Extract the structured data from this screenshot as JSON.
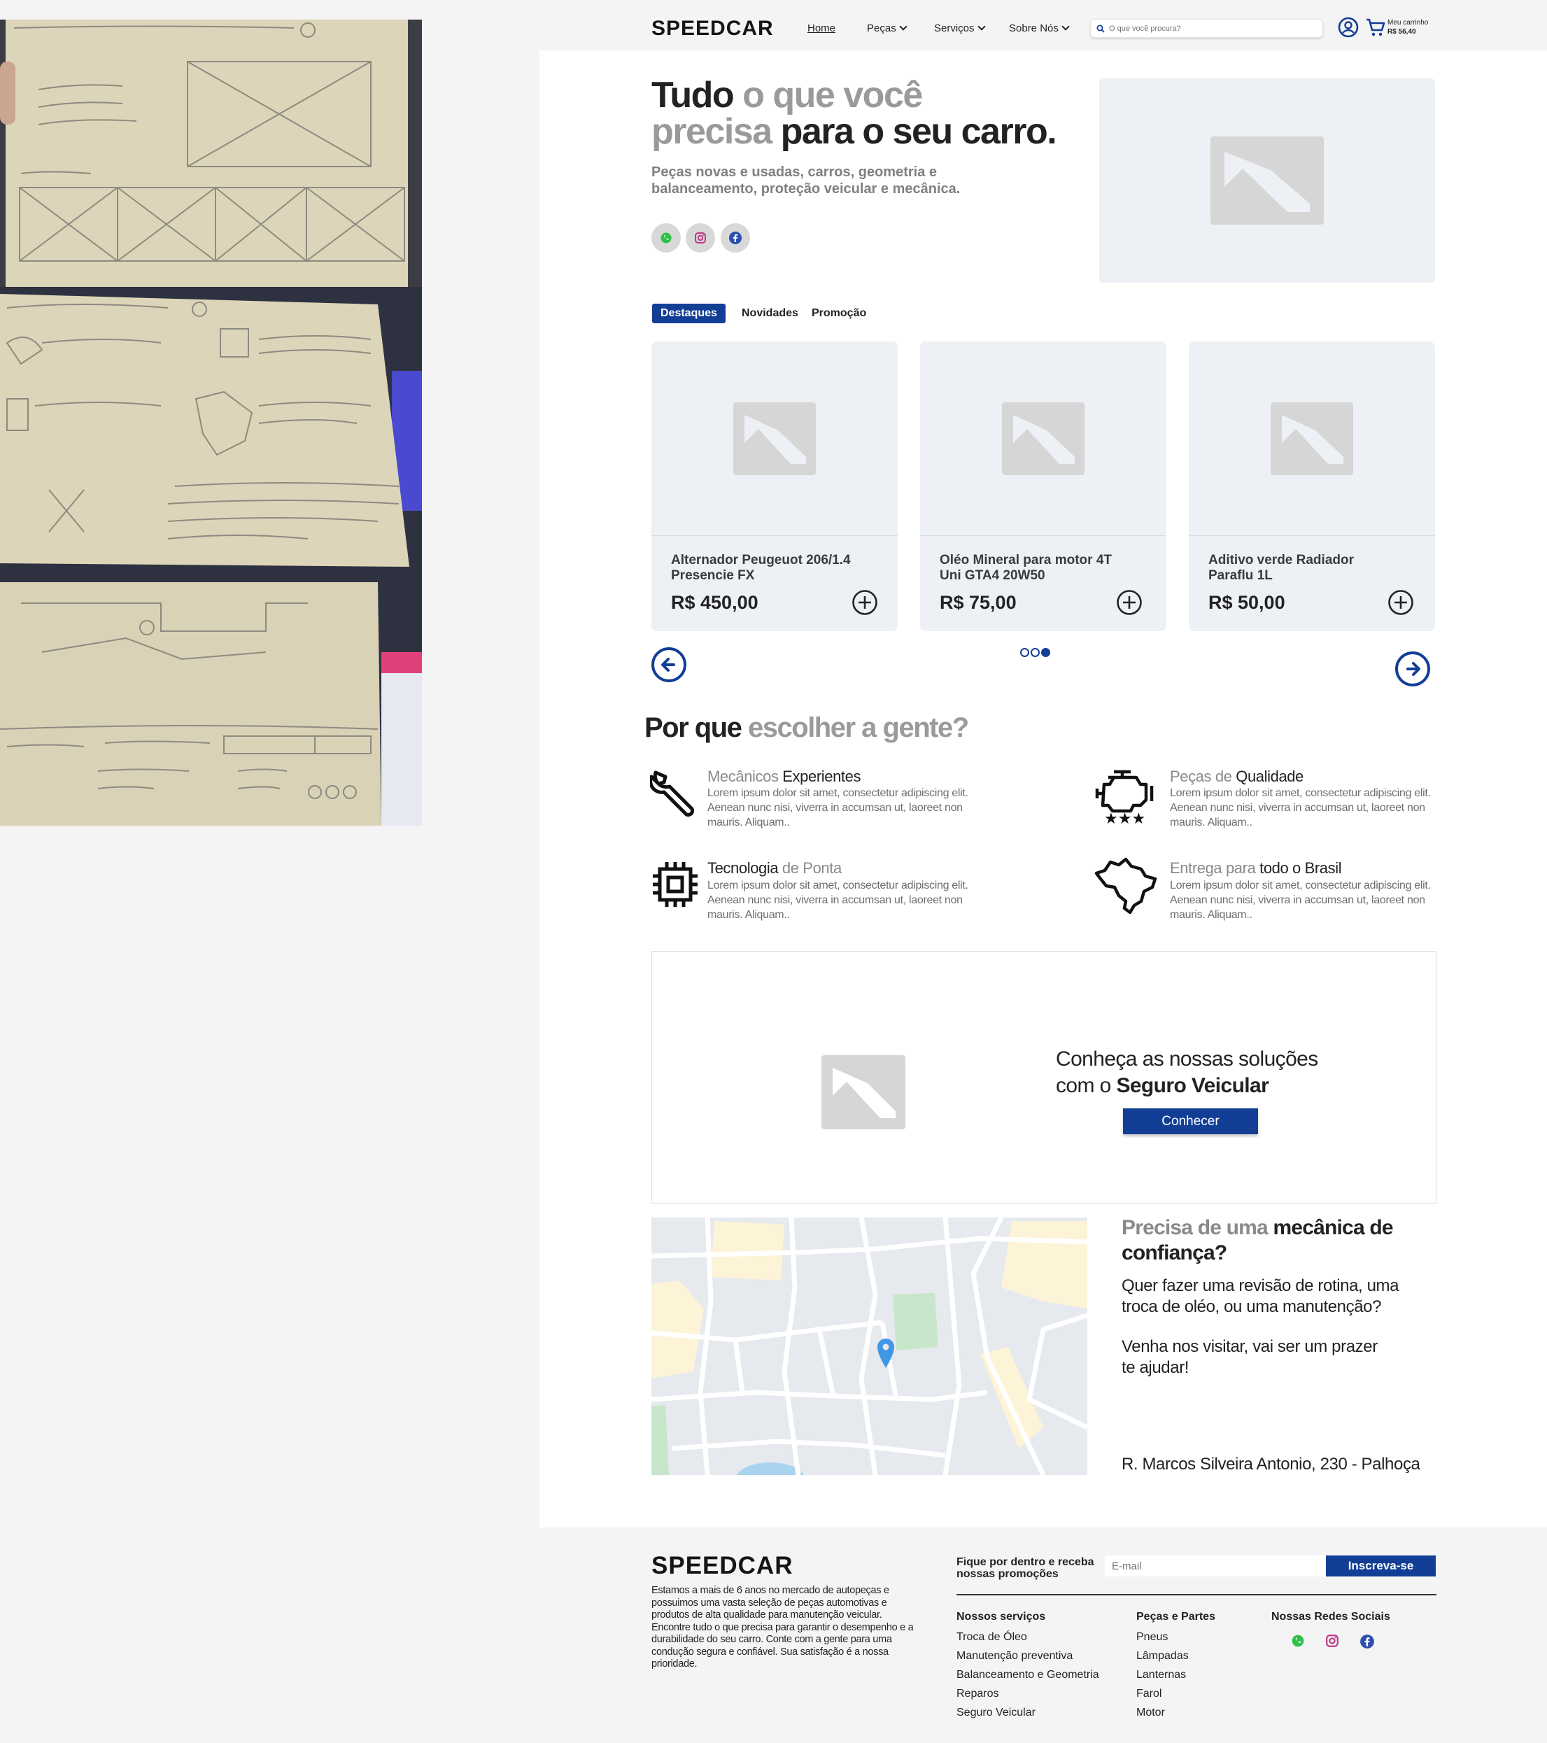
{
  "nav": {
    "logo": "SPEEDCAR",
    "links": [
      {
        "label": "Home",
        "active": true
      },
      {
        "label": "Peças"
      },
      {
        "label": "Serviços"
      },
      {
        "label": "Sobre Nós"
      }
    ],
    "search_placeholder": "O que você procura?",
    "cart_label": "Meu carrinho",
    "cart_total": "R$ 56,40"
  },
  "hero": {
    "title_dark_1": "Tudo",
    "title_grey_1": " o que você",
    "title_grey_2": "precisa",
    "title_dark_2": " para o seu carro.",
    "subtitle": "Peças novas e usadas, carros, geometria e balanceamento, proteção veicular e mecânica.",
    "socials": [
      "whatsapp-icon",
      "instagram-icon",
      "facebook-icon"
    ]
  },
  "tabs": [
    "Destaques",
    "Novidades",
    "Promoção"
  ],
  "products": [
    {
      "name": "Alternador Peugeuot 206/1.4 Presencie FX",
      "price": "R$ 450,00"
    },
    {
      "name": "Oléo Mineral para motor 4T Uni GTA4 20W50",
      "price": "R$ 75,00"
    },
    {
      "name": "Aditivo verde Radiador Paraflu 1L",
      "price": "R$ 50,00"
    }
  ],
  "why": {
    "title_dark": "Por que",
    "title_grey": " escolher a gente?",
    "features": [
      {
        "light": "Mecânicos ",
        "bold": "Experientes",
        "bold_weight": "normal",
        "text": "Lorem ipsum dolor sit amet, consectetur adipiscing elit. Aenean nunc nisi, viverra in accumsan ut, laoreet non mauris. Aliquam..",
        "icon": "wrench-icon"
      },
      {
        "light": "Peças de ",
        "bold": "Qualidade",
        "text": "Lorem ipsum dolor sit amet, consectetur adipiscing elit. Aenean nunc nisi, viverra in accumsan ut, laoreet non mauris. Aliquam..",
        "icon": "engine-icon"
      },
      {
        "light": "",
        "bold": "Tecnologia",
        "light2": " de Ponta",
        "text": "Lorem ipsum dolor sit amet, consectetur adipiscing elit. Aenean nunc nisi, viverra in accumsan ut, laoreet non mauris. Aliquam..",
        "icon": "chip-icon"
      },
      {
        "light": "Entrega para ",
        "bold": "todo o Brasil",
        "text": "Lorem ipsum dolor sit amet, consectetur adipiscing elit. Aenean nunc nisi, viverra in accumsan ut, laoreet non mauris. Aliquam..",
        "icon": "brazil-map-icon"
      }
    ]
  },
  "insurance": {
    "line1": "Conheça as nossas soluções",
    "line2_prefix": "com o ",
    "line2_bold": "Seguro Veicular",
    "cta": "Conhecer"
  },
  "visit": {
    "title_light": "Precisa de uma ",
    "title_bold": "mecânica de confiança?",
    "text1": "Quer fazer uma revisão de rotina, uma troca de oléo, ou uma manutenção?",
    "text2": "Venha nos visitar, vai ser um prazer te ajudar!",
    "address": "R. Marcos Silveira Antonio, 230 - Palhoça"
  },
  "footer": {
    "logo": "SPEEDCAR",
    "about": "Estamos a mais de 6 anos no mercado de autopeças e possuimos uma vasta seleção de peças automotivas e produtos de alta qualidade para manutenção veicular. Encontre tudo o que precisa para garantir o desempenho e a durabilidade do seu carro. Conte com a gente para uma condução segura e confiável. Sua satisfação é a nossa prioridade.",
    "newsletter_label": "Fique por dentro e receba nossas promoções",
    "email_placeholder": "E-mail",
    "subscribe": "Inscreva-se",
    "services_title": "Nossos serviços",
    "services": [
      "Troca de Óleo",
      "Manutenção preventiva",
      "Balanceamento e Geometria",
      "Reparos",
      "Seguro Veicular"
    ],
    "parts_title": "Peças e Partes",
    "parts": [
      "Pneus",
      "Lâmpadas",
      "Lanternas",
      "Farol",
      "Motor"
    ],
    "social_title": "Nossas Redes Sociais"
  },
  "colors": {
    "accent": "#123e95",
    "grey_text": "#9a9a9a",
    "placeholder_bg": "#edf1f5"
  }
}
